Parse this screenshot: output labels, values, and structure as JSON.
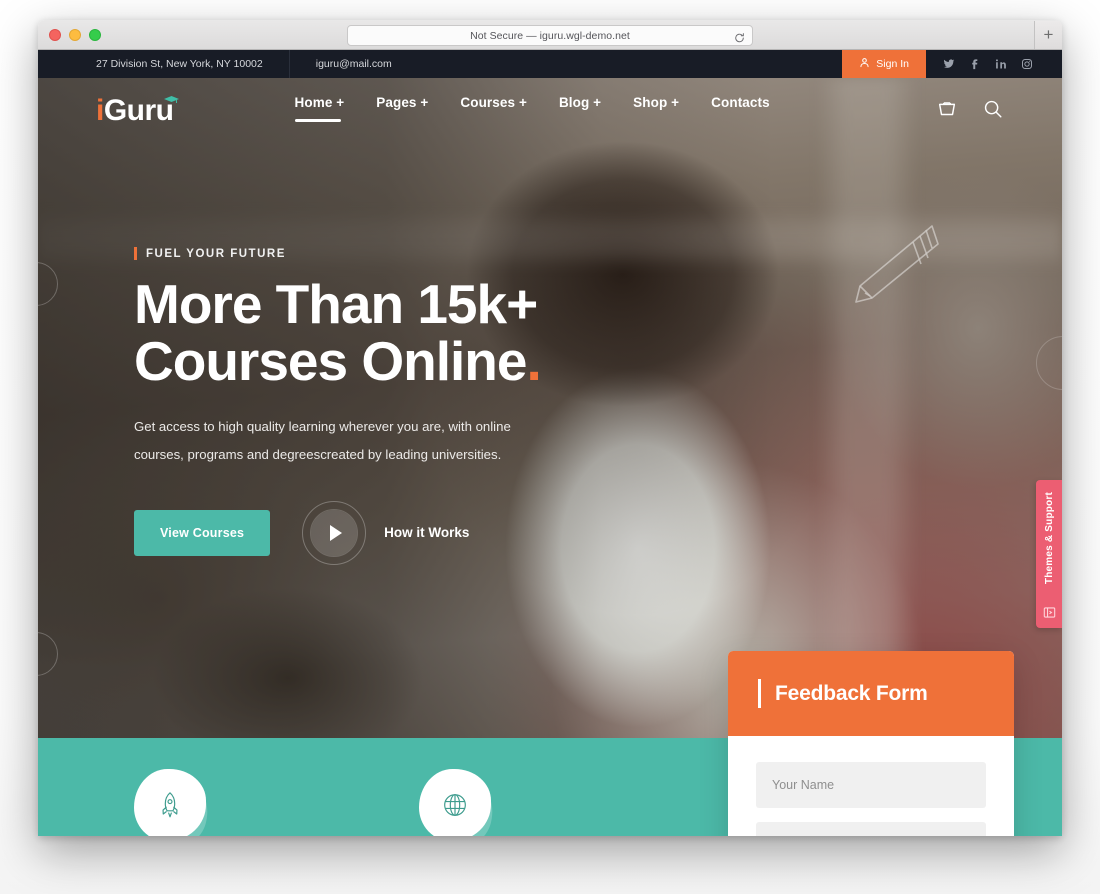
{
  "browser": {
    "url_text": "Not Secure — iguru.wgl-demo.net",
    "reload_label": "⟳",
    "newtab_label": "+"
  },
  "topbar": {
    "address": "27 Division St, New York, NY 10002",
    "email": "iguru@mail.com",
    "signin_label": "Sign In",
    "socials": [
      {
        "name": "twitter-icon"
      },
      {
        "name": "facebook-icon"
      },
      {
        "name": "linkedin-icon"
      },
      {
        "name": "instagram-icon"
      }
    ]
  },
  "nav": {
    "logo_i": "i",
    "logo_rest": "Guru",
    "items": [
      {
        "label": "Home +",
        "active": true
      },
      {
        "label": "Pages +",
        "active": false
      },
      {
        "label": "Courses +",
        "active": false
      },
      {
        "label": "Blog +",
        "active": false
      },
      {
        "label": "Shop +",
        "active": false
      },
      {
        "label": "Contacts",
        "active": false
      }
    ],
    "cart_icon": "cart-icon",
    "search_icon": "search-icon"
  },
  "hero": {
    "eyebrow": "FUEL YOUR FUTURE",
    "title_line1": "More Than 15k+",
    "title_line2": "Courses Online",
    "title_period": ".",
    "subtitle": "Get access to high quality learning wherever you are, with online courses, programs and degreescreated by leading universities.",
    "primary_button": "View Courses",
    "video_label": "How it Works"
  },
  "features": [
    {
      "icon": "rocket-icon"
    },
    {
      "icon": "globe-icon"
    }
  ],
  "feedback": {
    "title": "Feedback Form",
    "name_placeholder": "Your Name",
    "email_placeholder": ""
  },
  "side_tab": {
    "label": "Themes & Support",
    "icon": "support-window-icon"
  },
  "colors": {
    "accent_orange": "#ef7139",
    "accent_teal": "#4cb9a8",
    "topbar_dark": "#181c26",
    "side_tab_pink": "#ec5e72"
  }
}
